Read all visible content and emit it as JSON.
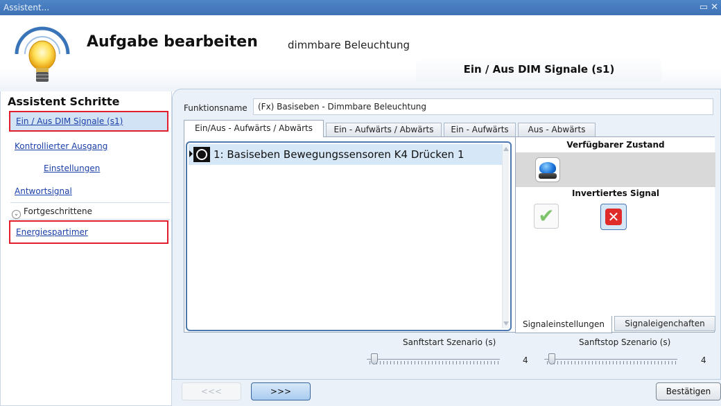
{
  "window": {
    "title": "Assistent...",
    "controls": "▭ ✕"
  },
  "header": {
    "title": "Aufgabe bearbeiten",
    "subtitle": "dimmbare Beleuchtung",
    "current_step": "Ein / Aus DIM Signale (s1)"
  },
  "sidebar": {
    "title": "Assistent Schritte",
    "items": [
      {
        "label": "Ein / Aus DIM Signale (s1)",
        "selected": true,
        "highlighted": true
      },
      {
        "label": "Kontrollierter Ausgang"
      },
      {
        "label": "Einstellungen"
      },
      {
        "label": "Antwortsignal"
      }
    ],
    "advanced": {
      "label": "Fortgeschrittene",
      "items": [
        {
          "label": "Energiespartimer",
          "highlighted": true
        }
      ]
    },
    "highlight_color": "#e21d2c"
  },
  "function": {
    "label": "Funktionsname",
    "value": "(Fx) Basiseben - Dimmbare Beleuchtung"
  },
  "tabs": [
    {
      "label": "Ein/Aus - Aufwärts / Abwärts",
      "active": true
    },
    {
      "label": "Ein - Aufwärts / Abwärts"
    },
    {
      "label": "Ein - Aufwärts"
    },
    {
      "label": "Aus - Abwärts"
    }
  ],
  "signal_list": {
    "items": [
      {
        "label": "1: Basiseben Bewegungssensoren K4 Drücken 1",
        "icon": "sensor-icon",
        "selected": true
      }
    ]
  },
  "right_panel": {
    "available_state_title": "Verfügbarer Zustand",
    "available_state_icon": "blue-pushbutton-icon",
    "inverted_signal_title": "Invertiertes Signal",
    "inverted_options": [
      {
        "icon": "check-icon",
        "selected": false
      },
      {
        "icon": "x-icon",
        "selected": true
      }
    ],
    "tabs": [
      {
        "label": "Signaleinstellungen",
        "active": true
      },
      {
        "label": "Signaleigenchaften"
      }
    ]
  },
  "sliders": [
    {
      "label": "Sanftstart Szenario (s)",
      "value": "4"
    },
    {
      "label": "Sanftstop Szenario (s)",
      "value": "4"
    }
  ],
  "buttons": {
    "prev": "<<<",
    "next": ">>>",
    "confirm": "Bestätigen"
  },
  "colors": {
    "accent": "#4f86c8",
    "selection": "#d6e7f7",
    "panel_bg": "#eaf1f8"
  }
}
